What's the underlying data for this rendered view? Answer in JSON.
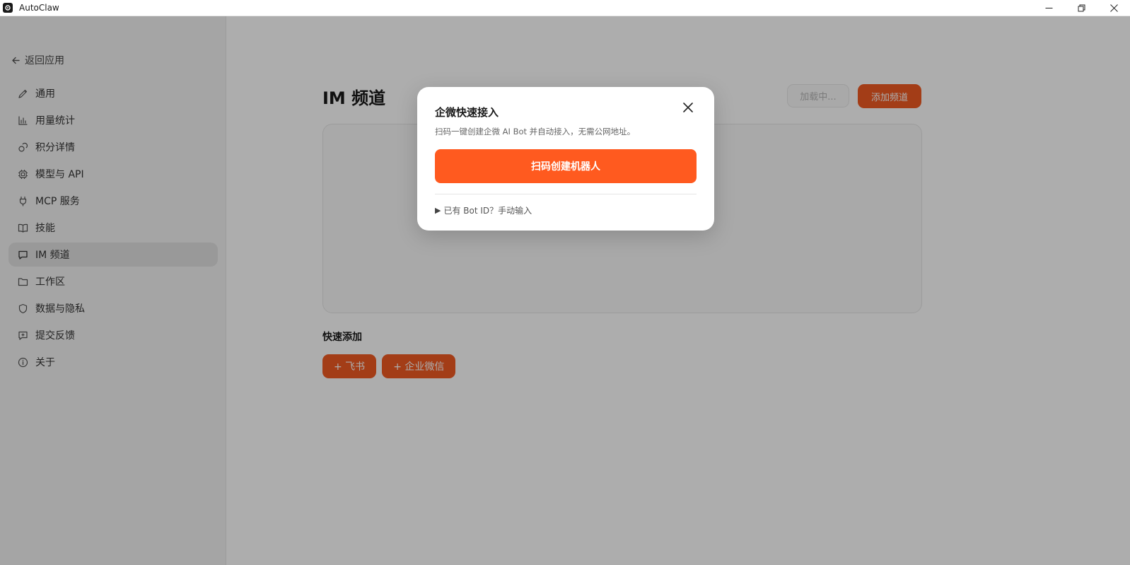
{
  "window": {
    "title": "AutoClaw"
  },
  "sidebar": {
    "back_label": "返回应用",
    "items": [
      {
        "label": "通用",
        "icon": "pencil-icon"
      },
      {
        "label": "用量统计",
        "icon": "bar-chart-icon"
      },
      {
        "label": "积分详情",
        "icon": "coins-icon"
      },
      {
        "label": "模型与 API",
        "icon": "cpu-icon"
      },
      {
        "label": "MCP 服务",
        "icon": "plug-icon"
      },
      {
        "label": "技能",
        "icon": "book-icon"
      },
      {
        "label": "IM 频道",
        "icon": "chat-icon",
        "active": true
      },
      {
        "label": "工作区",
        "icon": "folder-icon"
      },
      {
        "label": "数据与隐私",
        "icon": "shield-icon"
      },
      {
        "label": "提交反馈",
        "icon": "feedback-icon"
      },
      {
        "label": "关于",
        "icon": "info-icon"
      }
    ]
  },
  "main": {
    "title": "IM 频道",
    "loading_label": "加载中...",
    "add_channel_label": "添加频道",
    "quick_add_title": "快速添加",
    "quick_add_buttons": [
      "+ 飞书",
      "+ 企业微信"
    ]
  },
  "dialog": {
    "title": "企微快速接入",
    "description": "扫码一键创建企微 AI Bot 并自动接入，无需公网地址。",
    "primary_label": "扫码创建机器人",
    "manual_caret": "▶",
    "manual_label": "已有 Bot ID？手动输入"
  },
  "colors": {
    "accent": "#f05a22",
    "dialog_primary": "#ff5a1f"
  }
}
